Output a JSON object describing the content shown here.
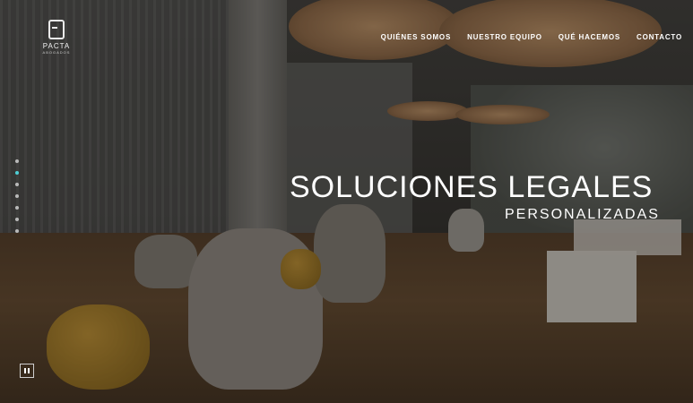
{
  "brand": {
    "name": "PACTA",
    "tagline": "ABOGADOS"
  },
  "nav": {
    "items": [
      "QUIÉNES SOMOS",
      "NUESTRO EQUIPO",
      "QUÉ HACEMOS",
      "CONTACTO"
    ]
  },
  "hero": {
    "title": "SOLUCIONES LEGALES",
    "subtitle": "PERSONALIZADAS",
    "slide_count": 7,
    "active_slide": 2
  },
  "icons": {
    "pause": "pause-icon",
    "logo": "pacta-logo-icon"
  },
  "colors": {
    "accent": "#4fd0d6",
    "text": "#ffffff"
  }
}
